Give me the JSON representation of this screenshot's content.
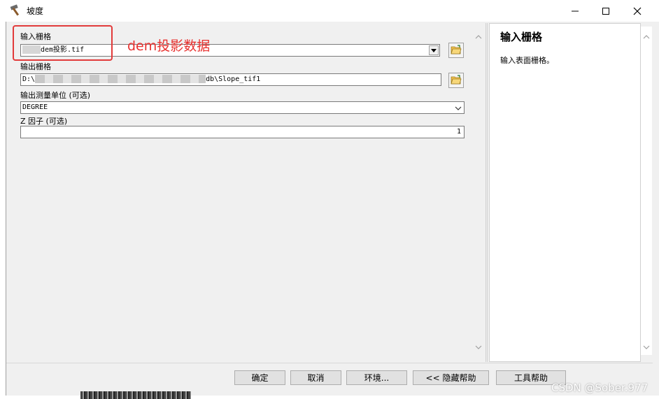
{
  "window": {
    "title": "坡度"
  },
  "annotation": {
    "text": "dem投影数据",
    "color": "#e8302e"
  },
  "fields": {
    "input_raster": {
      "label": "输入栅格",
      "value": "dem投影.tif"
    },
    "output_raster": {
      "label": "输出栅格",
      "value_prefix": "D:\\",
      "value_suffix": "db\\Slope_tif1"
    },
    "output_measurement": {
      "label": "输出测量单位 (可选)",
      "value": "DEGREE"
    },
    "z_factor": {
      "label": "Z 因子 (可选)",
      "value": "1"
    }
  },
  "help_panel": {
    "title": "输入栅格",
    "description": "输入表面栅格。"
  },
  "buttons": {
    "ok": "确定",
    "cancel": "取消",
    "environments": "环境...",
    "hide_help": "<< 隐藏帮助",
    "tool_help": "工具帮助"
  },
  "watermark": "CSDN @Sober.977"
}
